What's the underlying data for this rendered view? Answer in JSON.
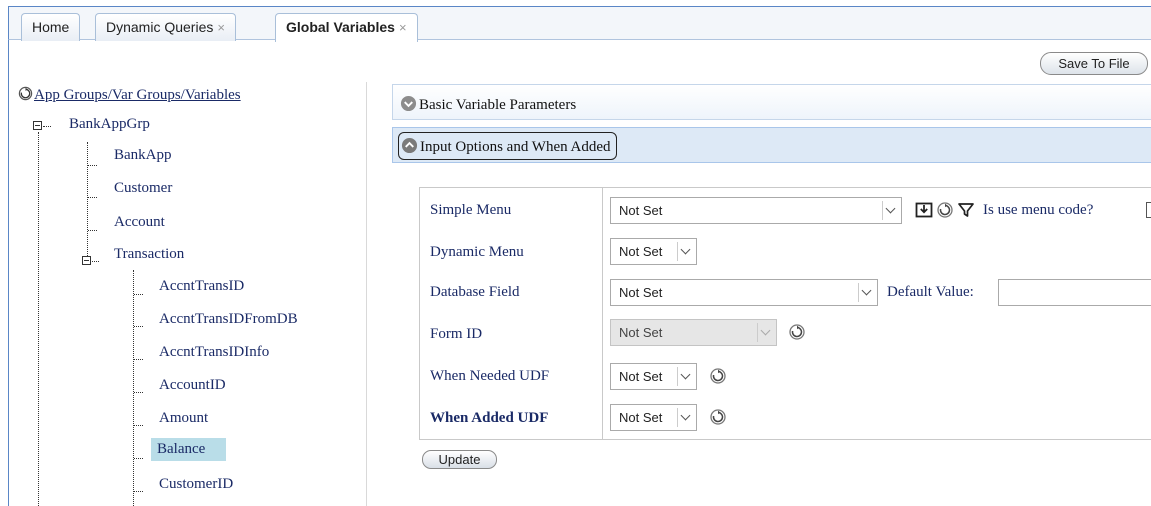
{
  "tabs": [
    {
      "label": "Home",
      "closable": false,
      "active": false
    },
    {
      "label": "Dynamic Queries",
      "closable": true,
      "active": false
    },
    {
      "label": "Global Variables",
      "closable": true,
      "active": true
    }
  ],
  "tab_close_glyph": "×",
  "toolbar": {
    "save_label": "Save To File"
  },
  "tree": {
    "root_label": "App Groups/Var Groups/Variables",
    "root_icon": "refresh-circle-icon",
    "nodes": {
      "bankappgrp": "BankAppGrp",
      "bankapp": "BankApp",
      "customer": "Customer",
      "account": "Account",
      "transaction": "Transaction",
      "accnttransid": "AccntTransID",
      "accnttransidfromdb": "AccntTransIDFromDB",
      "accnttransidinfo": "AccntTransIDInfo",
      "accountid": "AccountID",
      "amount": "Amount",
      "balance": "Balance",
      "customerid": "CustomerID"
    },
    "selected": "Balance"
  },
  "accordion": {
    "basic_label": "Basic Variable Parameters",
    "input_label": "Input Options and When Added"
  },
  "form": {
    "simple_menu": {
      "label": "Simple Menu",
      "value": "Not Set",
      "menu_code_label": "Is use menu code?"
    },
    "dynamic_menu": {
      "label": "Dynamic Menu",
      "value": "Not Set"
    },
    "database_field": {
      "label": "Database Field",
      "value": "Not Set",
      "default_label": "Default Value:",
      "default_value": ""
    },
    "form_id": {
      "label": "Form ID",
      "value": "Not Set"
    },
    "when_needed_udf": {
      "label": "When Needed UDF",
      "value": "Not Set"
    },
    "when_added_udf": {
      "label": "When Added UDF",
      "value": "Not Set"
    },
    "update_label": "Update"
  },
  "colors": {
    "accent": "#5a86c6",
    "selected_bg": "#b9dde8",
    "accordion_bg": "#dde9f6",
    "label_text": "#1a2a66"
  }
}
